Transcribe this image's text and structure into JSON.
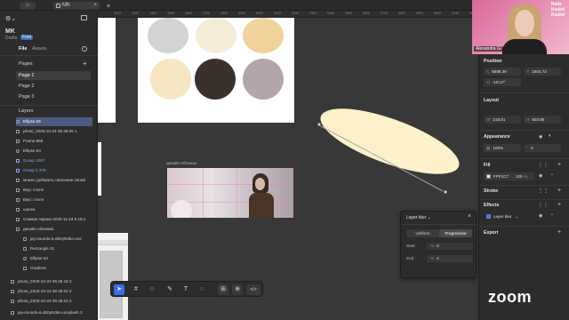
{
  "browser": {
    "home_tab": "⌂",
    "file_tab": "MK",
    "close": "×",
    "new_tab": "+"
  },
  "ruler": {
    "ticks": [
      "4200",
      "4300",
      "4400",
      "4500",
      "4600",
      "4700",
      "4800",
      "4900",
      "5000",
      "5100",
      "5200",
      "5300",
      "5400",
      "5500",
      "5600",
      "5700",
      "5800",
      "5900",
      "6000",
      "6100",
      "6200"
    ]
  },
  "left": {
    "file_name": "MK",
    "drafts": "Drafts",
    "free_badge": "Free",
    "seg_file": "File",
    "seg_assets": "Assets",
    "pages_label": "Pages",
    "add": "+",
    "pages": [
      "Page 1",
      "Page 2",
      "Page 3"
    ],
    "layers_label": "Layers",
    "layers": [
      "Ellipse 65",
      "photo_2025-10-24 09.39.09 1",
      "Frame 868",
      "Ellipse 64",
      "Group 1087",
      "Group 1 378",
      "можно добавить описание своей",
      "Вкус стиля",
      "Вкус стиля",
      "шапка",
      "Снимок экрана 2025-11-24 в 16:1",
      "дизайн обложка",
      "jay-soundo-iLxbDyN3ko-uns",
      "Rectangle 31",
      "Ellipse 63",
      "Gradient",
      "photo_2025-10-24 09.39.18 2",
      "photo_2025-10-24 09.39.04 2",
      "photo_2025-10-24 09.39.03 2",
      "jay-soundo-iLxbDyN3ko-unsplash 3"
    ]
  },
  "canvas": {
    "cover_label": "дизайн обложка",
    "colors": {
      "swatch_gray": "#d3d3d3",
      "swatch_cream": "#f5ecd8",
      "swatch_sand": "#f0d39b",
      "swatch_pale": "#f6e6c2",
      "swatch_dark": "#3a302c",
      "swatch_taupe": "#b2a6a8",
      "ellipse_fill": "#fcf1c8"
    }
  },
  "popover": {
    "title": "Layer blur",
    "chevron": "⌄",
    "close": "×",
    "uniform": "Uniform",
    "progressive": "Progressive",
    "start_label": "Start",
    "start_value": "0",
    "end_label": "End",
    "end_value": "4",
    "pct": "%"
  },
  "toolbar": {
    "move": "➤",
    "frame": "#",
    "shape": "○",
    "pen": "✎",
    "text": "T",
    "comment": "◌",
    "actions": "⊞",
    "dev": "</>"
  },
  "right": {
    "position_label": "Position",
    "x_label": "X",
    "x_value": "6698.39",
    "y_label": "Y",
    "y_value": "1804.73",
    "rotation_label": "⟲",
    "rotation_value": "-18.17°",
    "layout_label": "Layout",
    "w_label": "W",
    "w_value": "218.01",
    "h_label": "H",
    "h_value": "603.85",
    "appearance_label": "Appearance",
    "opacity_value": "100%",
    "radius_value": "0",
    "fill_label": "Fill",
    "fill_hex": "FFF1C7",
    "fill_opacity": "100",
    "fill_pct": "%",
    "stroke_label": "Stroke",
    "effects_label": "Effects",
    "effect_name": "Layer blur",
    "export_label": "Export",
    "zoom": "zoom",
    "fill_color": "#fff1c7"
  },
  "cam": {
    "name": "Alexandra Gl",
    "sign_line1": "Nails",
    "sign_line2": "Kaskd",
    "sign_line3": "Kaskd"
  }
}
